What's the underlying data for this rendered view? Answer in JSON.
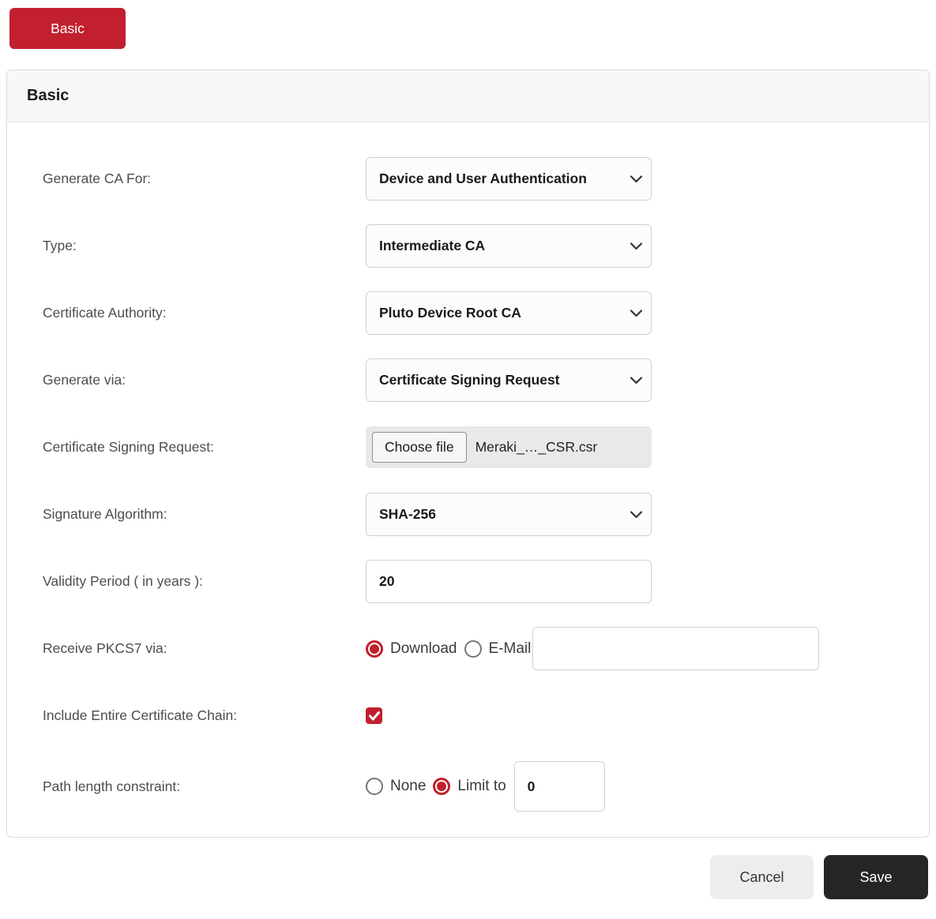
{
  "tab": {
    "label": "Basic"
  },
  "panel": {
    "title": "Basic"
  },
  "form": {
    "fields": [
      {
        "label": "Generate CA For:",
        "value": "Device and User Authentication"
      },
      {
        "label": "Type:",
        "value": "Intermediate CA"
      },
      {
        "label": "Certificate Authority:",
        "value": "Pluto Device Root CA"
      },
      {
        "label": "Generate via:",
        "value": "Certificate Signing Request"
      },
      {
        "label": "Certificate Signing Request:",
        "button_label": "Choose file",
        "file_name": "Meraki_…_CSR.csr"
      },
      {
        "label": "Signature Algorithm:",
        "value": "SHA-256"
      },
      {
        "label": "Validity Period ( in years ):",
        "value": "20"
      },
      {
        "label": "Receive PKCS7 via:",
        "options": [
          {
            "label": "Download",
            "selected": true
          },
          {
            "label": "E-Mail",
            "selected": false
          }
        ],
        "email_value": ""
      },
      {
        "label": "Include Entire Certificate Chain:",
        "checked": true
      },
      {
        "label": "Path length constraint:",
        "options": [
          {
            "label": "None",
            "selected": false
          },
          {
            "label": "Limit to",
            "selected": true
          }
        ],
        "limit_value": "0"
      }
    ]
  },
  "footer": {
    "cancel_label": "Cancel",
    "save_label": "Save"
  },
  "colors": {
    "accent_red": "#c2202e",
    "save_button_bg": "#262626",
    "panel_header_bg": "#f8f8f8"
  }
}
